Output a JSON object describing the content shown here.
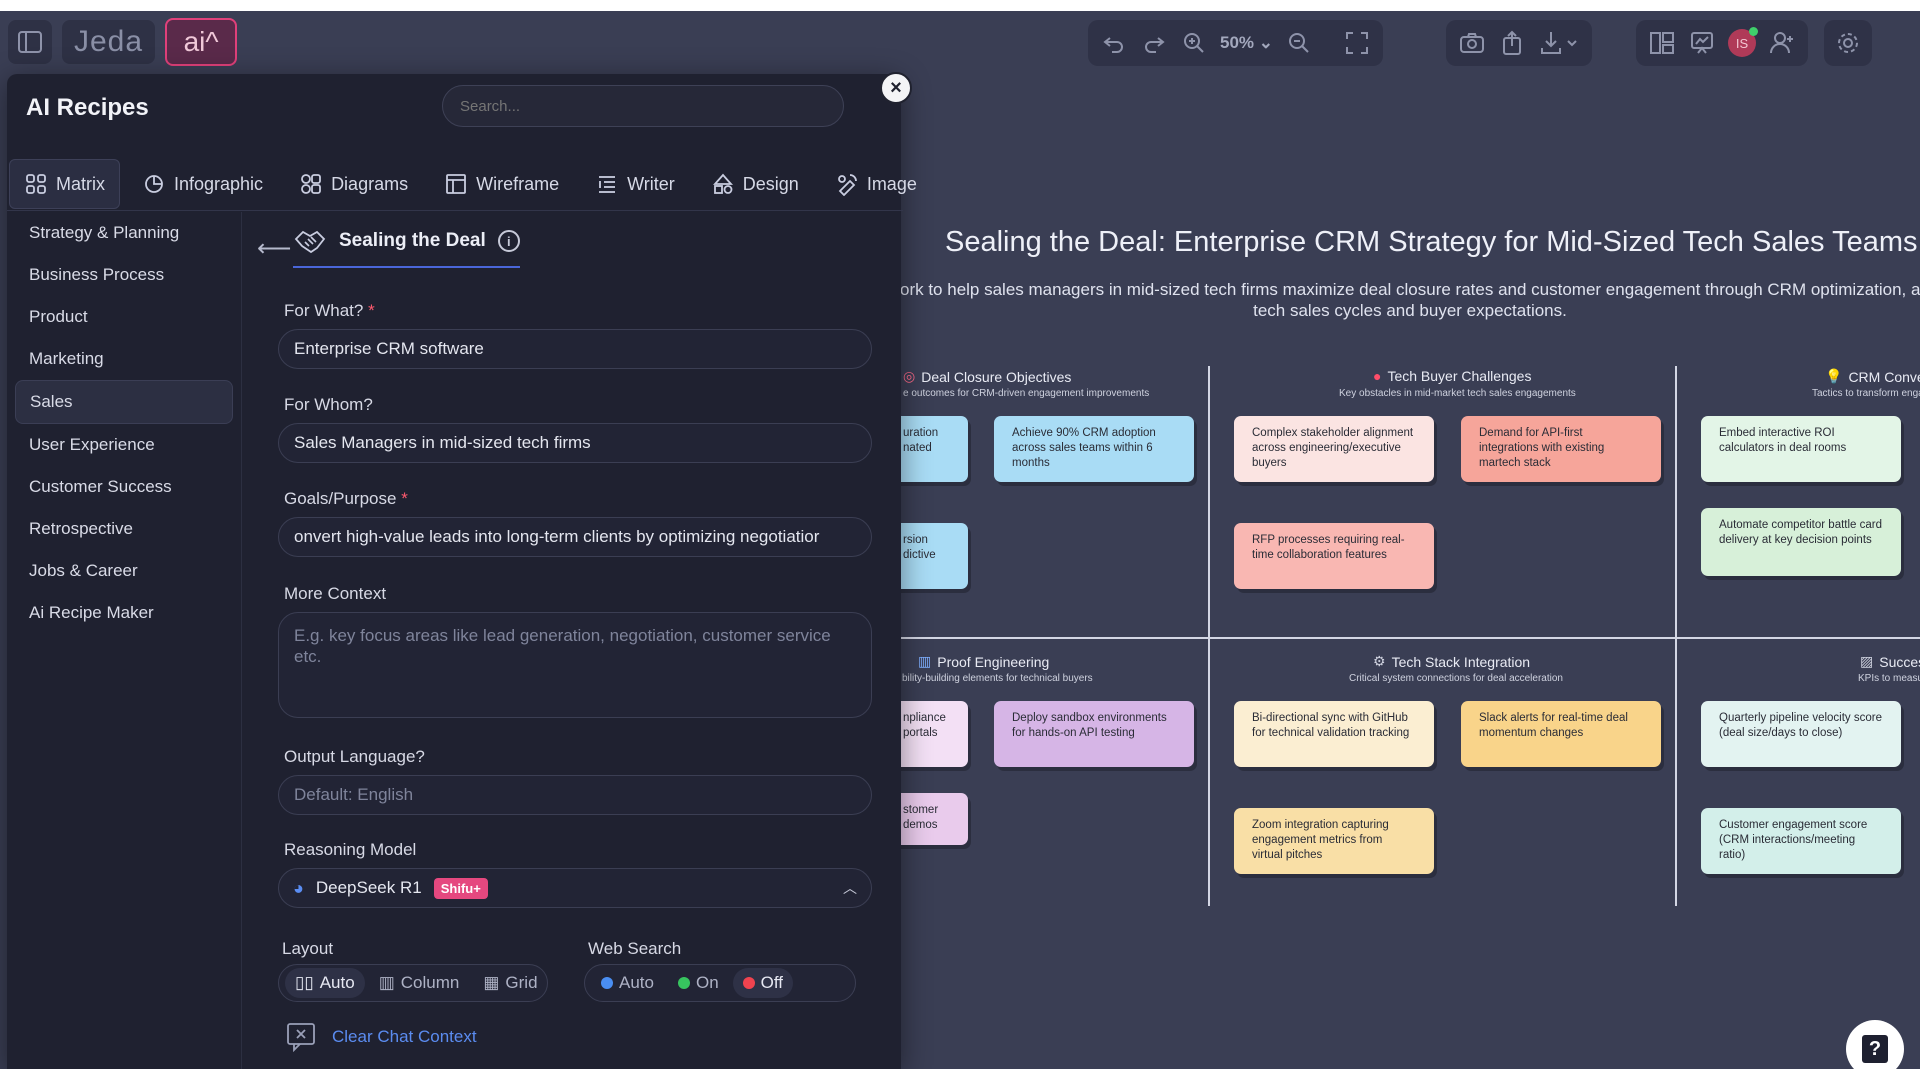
{
  "app": {
    "logo": "Jeda",
    "ai_label": "ai^"
  },
  "toolbar": {
    "zoom": "50%"
  },
  "user": {
    "initials": "IS"
  },
  "panel": {
    "title": "AI Recipes",
    "search_placeholder": "Search...",
    "close_label": "×",
    "tabs": [
      {
        "label": "Matrix",
        "icon": "matrix-icon"
      },
      {
        "label": "Infographic",
        "icon": "infographic-icon"
      },
      {
        "label": "Diagrams",
        "icon": "diagrams-icon"
      },
      {
        "label": "Wireframe",
        "icon": "wireframe-icon"
      },
      {
        "label": "Writer",
        "icon": "writer-icon"
      },
      {
        "label": "Design",
        "icon": "design-icon"
      },
      {
        "label": "Image",
        "icon": "image-icon"
      }
    ],
    "categories": [
      "Strategy & Planning",
      "Business Process",
      "Product",
      "Marketing",
      "Sales",
      "User Experience",
      "Customer Success",
      "Retrospective",
      "Jobs & Career",
      "Ai Recipe Maker"
    ],
    "active_category": "Sales"
  },
  "recipe": {
    "back": "⟵",
    "title": "Sealing the Deal",
    "info": "i",
    "for_what_label": "For What?",
    "for_what_value": "Enterprise CRM software",
    "for_whom_label": "For Whom?",
    "for_whom_value": "Sales Managers in mid-sized tech firms",
    "goals_label": "Goals/Purpose",
    "goals_value": "onvert high-value leads into long-term clients by optimizing negotiatior",
    "context_label": "More Context",
    "context_placeholder": "E.g. key focus areas like lead generation, negotiation, customer service etc.",
    "language_label": "Output Language?",
    "language_placeholder": "Default: English",
    "model_label": "Reasoning Model",
    "model_value": "DeepSeek R1",
    "model_badge": "Shifu+",
    "layout_label": "Layout",
    "layout_options": [
      "Auto",
      "Column",
      "Grid"
    ],
    "websearch_label": "Web Search",
    "websearch_options": [
      "Auto",
      "On",
      "Off"
    ],
    "clear_label": "Clear Chat Context"
  },
  "canvas": {
    "title": "Sealing the Deal: Enterprise CRM Strategy for Mid-Sized Tech Sales Teams",
    "subtitle_1": "ork to help sales managers in mid-sized tech firms maximize deal closure rates and customer engagement through CRM optimization, addr",
    "subtitle_2": "tech sales cycles and buyer expectations.",
    "sections": [
      {
        "title": "Deal Closure Objectives",
        "sub": "e outcomes for CRM-driven engagement improvements"
      },
      {
        "title": "Tech Buyer Challenges",
        "sub": "Key obstacles in mid-market tech sales engagements"
      },
      {
        "title": "CRM Conver",
        "sub": "Tactics to transform engag"
      },
      {
        "title": "Proof Engineering",
        "sub": "bility-building elements for technical buyers"
      },
      {
        "title": "Tech Stack Integration",
        "sub": "Critical system connections for deal acceleration"
      },
      {
        "title": "Succes",
        "sub": "KPIs to measure engag"
      }
    ],
    "notes": [
      "uration\nnated",
      "Achieve 90% CRM adoption across sales teams within 6 months",
      "Complex stakeholder alignment across engineering/executive buyers",
      "Demand for API-first integrations with existing martech stack",
      "Embed interactive ROI calculators in deal rooms",
      "rsion\ndictive",
      "RFP processes requiring real-time collaboration features",
      "Automate competitor battle card delivery at key decision points",
      "npliance\nportals",
      "Deploy sandbox environments for hands-on API testing",
      "Bi-directional sync with GitHub for technical validation tracking",
      "Slack alerts for real-time deal momentum changes",
      "Quarterly pipeline velocity score (deal size/days to close)",
      "stomer\ndemos",
      "Zoom integration capturing engagement metrics from virtual pitches",
      "Customer engagement score (CRM interactions/meeting ratio)"
    ]
  },
  "help": "?",
  "colors": {
    "accent_pink": "#e0407a",
    "note_blue": "#a9dcf5",
    "note_peach": "#fbe4e2",
    "note_salmon": "#f6a59a",
    "note_mint": "#e3f5e7",
    "note_lilac": "#d6b5e6",
    "note_cream": "#fbeed2",
    "note_orange": "#f9d48a",
    "note_aqua": "#d3efea"
  }
}
